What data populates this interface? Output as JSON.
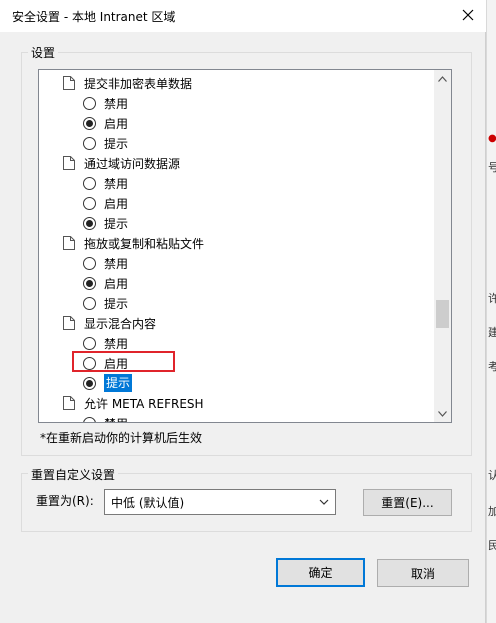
{
  "window": {
    "title": "安全设置 - 本地 Intranet 区域"
  },
  "settings_group": {
    "legend": "设置"
  },
  "list": [
    {
      "kind": "setting",
      "label": "提交非加密表单数据"
    },
    {
      "kind": "option",
      "label": "禁用",
      "checked": false
    },
    {
      "kind": "option",
      "label": "启用",
      "checked": true
    },
    {
      "kind": "option",
      "label": "提示",
      "checked": false
    },
    {
      "kind": "setting",
      "label": "通过域访问数据源"
    },
    {
      "kind": "option",
      "label": "禁用",
      "checked": false
    },
    {
      "kind": "option",
      "label": "启用",
      "checked": false
    },
    {
      "kind": "option",
      "label": "提示",
      "checked": true
    },
    {
      "kind": "setting",
      "label": "拖放或复制和粘贴文件"
    },
    {
      "kind": "option",
      "label": "禁用",
      "checked": false
    },
    {
      "kind": "option",
      "label": "启用",
      "checked": true
    },
    {
      "kind": "option",
      "label": "提示",
      "checked": false
    },
    {
      "kind": "setting",
      "label": "显示混合内容"
    },
    {
      "kind": "option",
      "label": "禁用",
      "checked": false
    },
    {
      "kind": "option",
      "label": "启用",
      "checked": false
    },
    {
      "kind": "option",
      "label": "提示",
      "checked": true,
      "selected": true
    },
    {
      "kind": "setting",
      "label": "允许 META REFRESH"
    },
    {
      "kind": "option",
      "label": "禁用",
      "checked": false
    }
  ],
  "restart_note": "*在重新启动你的计算机后生效",
  "reset_group": {
    "legend": "重置自定义设置",
    "reset_to_label": "重置为(R):",
    "reset_level": "中低 (默认值)",
    "reset_button": "重置(E)..."
  },
  "buttons": {
    "ok": "确定",
    "cancel": "取消"
  },
  "background_window": {
    "glyphs": [
      "号",
      "许",
      "建",
      "考",
      "认",
      "加",
      "民"
    ]
  }
}
